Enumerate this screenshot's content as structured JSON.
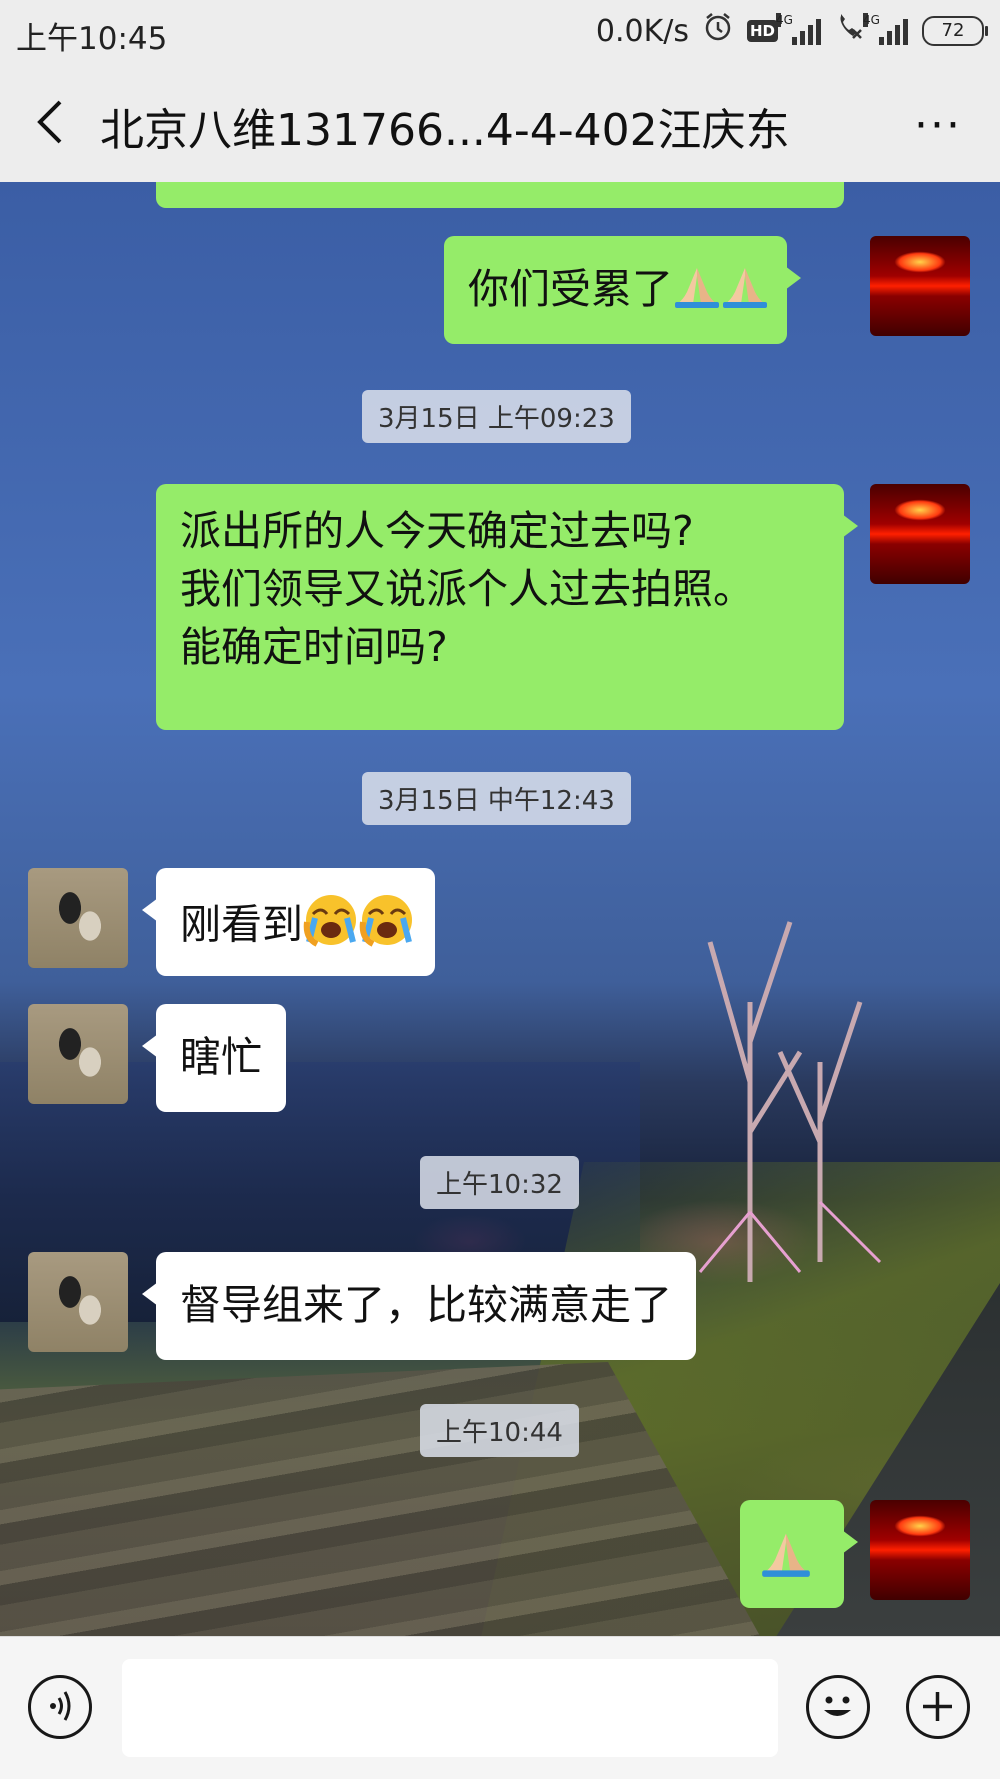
{
  "status_bar": {
    "time": "上午10:45",
    "net_speed": "0.0K/s",
    "hd_badge": "HD",
    "network_1": "4G",
    "network_2": "4G",
    "battery": "72"
  },
  "header": {
    "title": "北京八维131766...4-4-402汪庆东",
    "more": "···"
  },
  "messages": [
    {
      "type": "self",
      "text": "你们受累了",
      "emoji": [
        "folded-hands",
        "folded-hands"
      ]
    },
    {
      "type": "timestamp",
      "text": "3月15日 上午09:23"
    },
    {
      "type": "self",
      "lines": [
        "派出所的人今天确定过去吗?",
        "我们领导又说派个人过去拍照。",
        "能确定时间吗?"
      ]
    },
    {
      "type": "timestamp",
      "text": "3月15日 中午12:43"
    },
    {
      "type": "other",
      "text": "刚看到",
      "emoji": [
        "loudly-crying-face",
        "loudly-crying-face"
      ]
    },
    {
      "type": "other",
      "text": "瞎忙"
    },
    {
      "type": "timestamp",
      "text": "上午10:32"
    },
    {
      "type": "other",
      "text": "督导组来了，比较满意走了"
    },
    {
      "type": "timestamp",
      "text": "上午10:44"
    },
    {
      "type": "self",
      "text": "",
      "emoji": [
        "folded-hands"
      ]
    }
  ],
  "input": {
    "value": "",
    "placeholder": ""
  },
  "colors": {
    "self_bubble": "#95ec69",
    "other_bubble": "#ffffff",
    "bar_bg": "#ededed"
  }
}
